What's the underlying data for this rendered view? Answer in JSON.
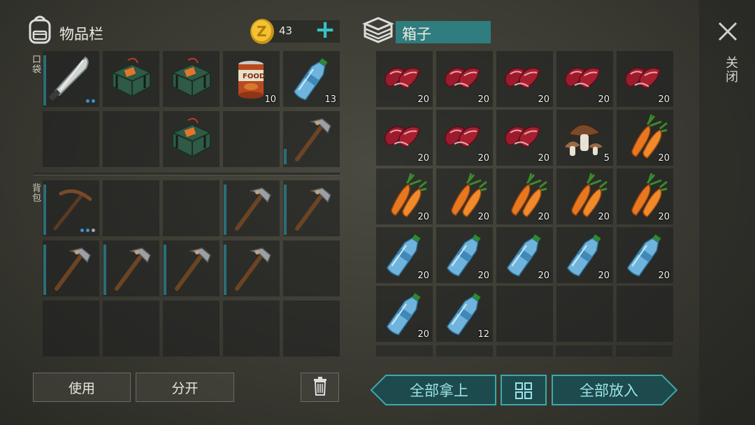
{
  "inventory": {
    "title": "物品栏",
    "coins": "43",
    "add_symbol": "+",
    "pocket_label": "口袋",
    "backpack_label": "背包"
  },
  "pocket_items": [
    {
      "item": "machete",
      "count": "",
      "durability": true,
      "dots": [
        "blue",
        "blue"
      ]
    },
    {
      "item": "explosive",
      "count": ""
    },
    {
      "item": "explosive",
      "count": ""
    },
    {
      "item": "canned-food",
      "count": "10",
      "can_text": "FOOD"
    },
    {
      "item": "water-bottle",
      "count": "13"
    },
    {
      "item": "empty"
    },
    {
      "item": "empty"
    },
    {
      "item": "explosive",
      "count": ""
    },
    {
      "item": "empty"
    },
    {
      "item": "hammer",
      "count": "",
      "durability_short": true
    }
  ],
  "backpack_items": [
    {
      "item": "pickaxe",
      "count": "",
      "durability": true,
      "dots": [
        "blue",
        "blue",
        "gray"
      ]
    },
    {
      "item": "empty"
    },
    {
      "item": "empty"
    },
    {
      "item": "hammer",
      "count": "",
      "durability": true
    },
    {
      "item": "hammer",
      "count": "",
      "durability": true
    },
    {
      "item": "hammer",
      "count": "",
      "durability": true
    },
    {
      "item": "hammer",
      "count": "",
      "durability": true
    },
    {
      "item": "hammer",
      "count": "",
      "durability": true
    },
    {
      "item": "hammer",
      "count": "",
      "durability": true
    },
    {
      "item": "empty"
    },
    {
      "item": "empty"
    },
    {
      "item": "empty"
    },
    {
      "item": "empty"
    },
    {
      "item": "empty"
    },
    {
      "item": "empty"
    }
  ],
  "box": {
    "title": "箱子",
    "items": [
      {
        "item": "raw-meat",
        "count": "20"
      },
      {
        "item": "raw-meat",
        "count": "20"
      },
      {
        "item": "raw-meat",
        "count": "20"
      },
      {
        "item": "raw-meat",
        "count": "20"
      },
      {
        "item": "raw-meat",
        "count": "20"
      },
      {
        "item": "raw-meat",
        "count": "20"
      },
      {
        "item": "raw-meat",
        "count": "20"
      },
      {
        "item": "raw-meat",
        "count": "20"
      },
      {
        "item": "mushroom",
        "count": "5"
      },
      {
        "item": "carrot",
        "count": "20"
      },
      {
        "item": "carrot",
        "count": "20"
      },
      {
        "item": "carrot",
        "count": "20"
      },
      {
        "item": "carrot",
        "count": "20"
      },
      {
        "item": "carrot",
        "count": "20"
      },
      {
        "item": "carrot",
        "count": "20"
      },
      {
        "item": "water-bottle",
        "count": "20"
      },
      {
        "item": "water-bottle",
        "count": "20"
      },
      {
        "item": "water-bottle",
        "count": "20"
      },
      {
        "item": "water-bottle",
        "count": "20"
      },
      {
        "item": "water-bottle",
        "count": "20"
      },
      {
        "item": "water-bottle",
        "count": "20"
      },
      {
        "item": "water-bottle",
        "count": "12"
      },
      {
        "item": "empty"
      },
      {
        "item": "empty"
      },
      {
        "item": "empty"
      }
    ]
  },
  "buttons": {
    "use": "使用",
    "split": "分开",
    "take_all": "全部拿上",
    "put_all": "全部放入",
    "close": "关闭"
  },
  "colors": {
    "accent_teal": "#2f7d7e",
    "slot_bg": "#1f2220",
    "count_text": "#f2f2ee"
  }
}
